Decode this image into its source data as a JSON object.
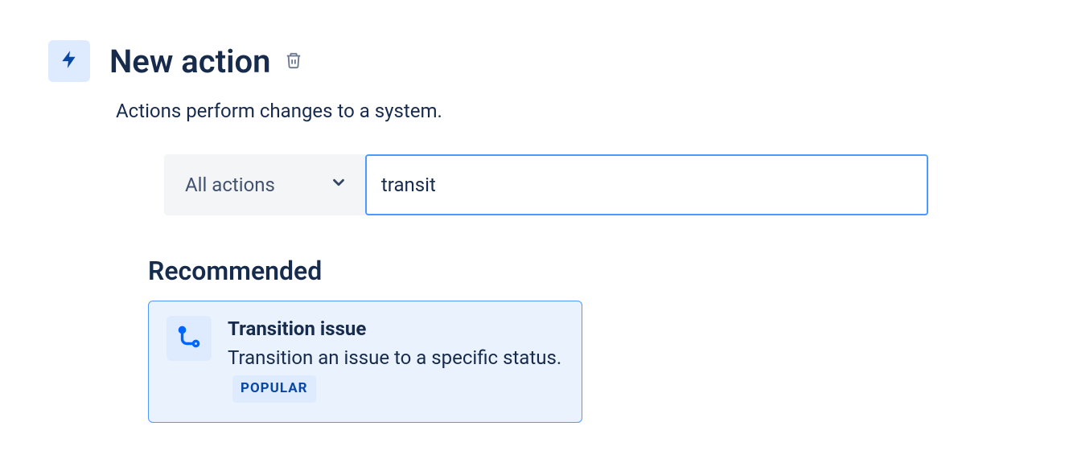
{
  "header": {
    "title": "New action",
    "subtitle": "Actions perform changes to a system."
  },
  "filter": {
    "dropdown_label": "All actions",
    "search_value": "transit"
  },
  "section": {
    "heading": "Recommended"
  },
  "result": {
    "title": "Transition issue",
    "description": "Transition an issue to a specific status.",
    "badge": "POPULAR"
  }
}
